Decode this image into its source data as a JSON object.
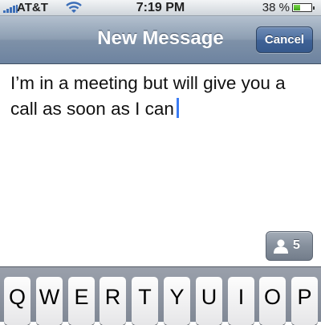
{
  "status_bar": {
    "carrier": "AT&T",
    "time": "7:19 PM",
    "battery_percent": "38 %",
    "battery_level": 0.38,
    "signal_icon": "signal-bars-icon",
    "wifi_icon": "wifi-icon",
    "battery_icon": "battery-icon"
  },
  "nav_bar": {
    "title": "New Message",
    "cancel_label": "Cancel"
  },
  "message": {
    "text_line1": "I’m in a meeting but will give you a",
    "text_line2": "call as soon as I can"
  },
  "contacts_button": {
    "icon": "person-icon",
    "count": "5"
  },
  "keyboard": {
    "row1": [
      "Q",
      "W",
      "E",
      "R",
      "T",
      "Y",
      "U",
      "I",
      "O",
      "P"
    ]
  },
  "colors": {
    "nav_accent": "#6d83a0",
    "cancel_button": "#3f6296",
    "cursor": "#3b7cf3",
    "battery_fill": "#4fbf22"
  }
}
